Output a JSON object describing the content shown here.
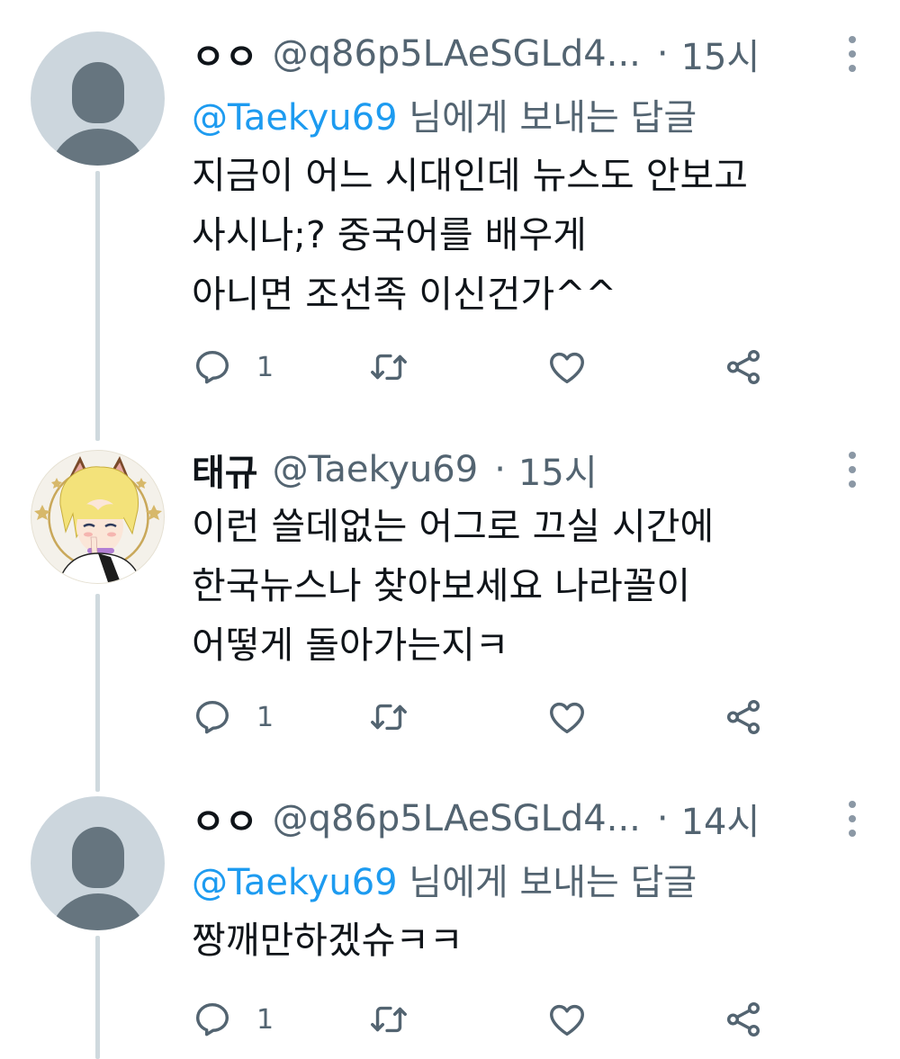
{
  "tweets": [
    {
      "display_name": "ㅇㅇ",
      "handle": "@q86p5LAeSGLd4...",
      "dot": "·",
      "time": "15시",
      "reply_prefix": "@Taekyu69",
      "reply_suffix": " 님에게 보내는 답글",
      "lines": [
        "지금이 어느 시대인데 뉴스도 안보고",
        "사시나;? 중국어를 배우게",
        "아니면 조선족 이신건가^^"
      ],
      "reply_count": "1"
    },
    {
      "display_name": "태규",
      "handle": "@Taekyu69",
      "dot": "·",
      "time": "15시",
      "lines": [
        "이런 쓸데없는 어그로 끄실 시간에",
        "한국뉴스나 찾아보세요 나라꼴이",
        "어떻게 돌아가는지ㅋ"
      ],
      "reply_count": "1"
    },
    {
      "display_name": "ㅇㅇ",
      "handle": "@q86p5LAeSGLd4...",
      "dot": "·",
      "time": "14시",
      "reply_prefix": "@Taekyu69",
      "reply_suffix": " 님에게 보내는 답글",
      "lines": [
        "짱깨만하겠슈ㅋㅋ"
      ],
      "reply_count": "1"
    }
  ],
  "icons": {
    "reply": "reply-icon",
    "retweet": "retweet-icon",
    "like": "heart-icon",
    "share": "share-icon",
    "more": "more-vertical-icon"
  },
  "colors": {
    "mention": "#1d9bf0",
    "secondary_text": "#536471",
    "thread_line": "#cfd9de",
    "default_avatar_bg": "#ccd6dd",
    "default_avatar_fg": "#66757f"
  }
}
